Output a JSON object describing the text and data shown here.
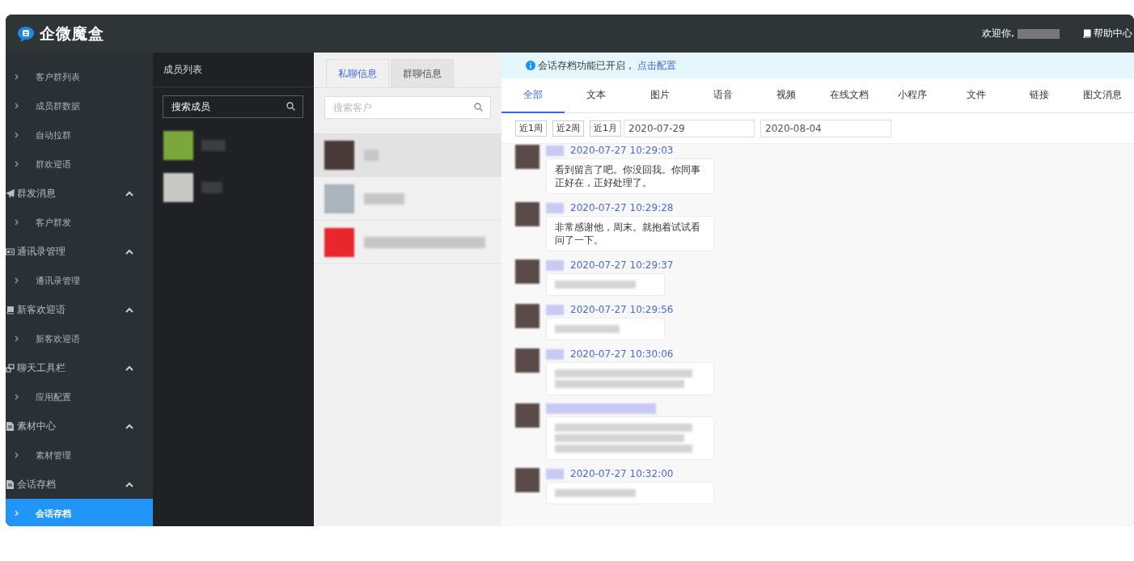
{
  "top_bar": {
    "logo_text": "企微魔盒",
    "welcome": "欢迎你,",
    "help": "帮助中心"
  },
  "sidebar": {
    "groups": [
      {
        "children": [
          {
            "label": "客户群列表",
            "selected": false
          },
          {
            "label": "成员群数据",
            "selected": false
          },
          {
            "label": "自动拉群",
            "selected": false
          },
          {
            "label": "群欢迎语",
            "selected": false
          }
        ]
      },
      {
        "title": "群发消息",
        "expanded": true,
        "children": [
          {
            "label": "客户群发",
            "selected": false
          }
        ]
      },
      {
        "title": "通讯录管理",
        "expanded": true,
        "children": [
          {
            "label": "通讯录管理",
            "selected": false
          }
        ]
      },
      {
        "title": "新客欢迎语",
        "expanded": true,
        "children": [
          {
            "label": "新客欢迎语",
            "selected": false
          }
        ]
      },
      {
        "title": "聊天工具栏",
        "expanded": true,
        "children": [
          {
            "label": "应用配置",
            "selected": false
          }
        ]
      },
      {
        "title": "素材中心",
        "expanded": true,
        "children": [
          {
            "label": "素材管理",
            "selected": false
          }
        ]
      },
      {
        "title": "会话存档",
        "expanded": true,
        "children": [
          {
            "label": "会话存档",
            "selected": true
          }
        ]
      }
    ]
  },
  "members": {
    "title": "成员列表",
    "search": {
      "placeholder": "搜索成员"
    }
  },
  "customers": {
    "tabs": [
      {
        "label": "私聊信息",
        "selected": true
      },
      {
        "label": "群聊信息",
        "selected": false
      }
    ],
    "search": {
      "placeholder": "搜索客户"
    },
    "contacts": [
      {
        "selected": true
      },
      {
        "selected": false
      },
      {
        "selected": false
      }
    ]
  },
  "main": {
    "notice": {
      "text": "会话存档功能已开启，",
      "link": "点击配置"
    },
    "type_tabs": [
      {
        "label": "全部",
        "selected": true
      },
      {
        "label": "文本",
        "selected": false
      },
      {
        "label": "图片",
        "selected": false
      },
      {
        "label": "语音",
        "selected": false
      },
      {
        "label": "视频",
        "selected": false
      },
      {
        "label": "在线文档",
        "selected": false
      },
      {
        "label": "小程序",
        "selected": false
      },
      {
        "label": "文件",
        "selected": false
      },
      {
        "label": "链接",
        "selected": false
      },
      {
        "label": "图文消息",
        "selected": false
      }
    ],
    "quick_ranges": [
      "近1周",
      "近2周",
      "近1月"
    ],
    "start_date": "2020-07-29",
    "end_date": "2020-08-04",
    "messages": [
      {
        "time": "2020-07-27 10:29:03",
        "kind": "text",
        "text": "看到留言了吧。你没回我。你同事正好在，正好处理了。"
      },
      {
        "time": "2020-07-27 10:29:28",
        "kind": "text",
        "text": "非常感谢他，周末。就抱着试试看问了一下。"
      },
      {
        "time": "2020-07-27 10:29:37",
        "kind": "hidden"
      },
      {
        "time": "2020-07-27 10:29:56",
        "kind": "hidden"
      },
      {
        "time": "2020-07-27 10:30:06",
        "kind": "hidden"
      },
      {
        "kind": "hidden"
      },
      {
        "time": "2020-07-27 10:32:00",
        "kind": "hidden"
      }
    ]
  }
}
